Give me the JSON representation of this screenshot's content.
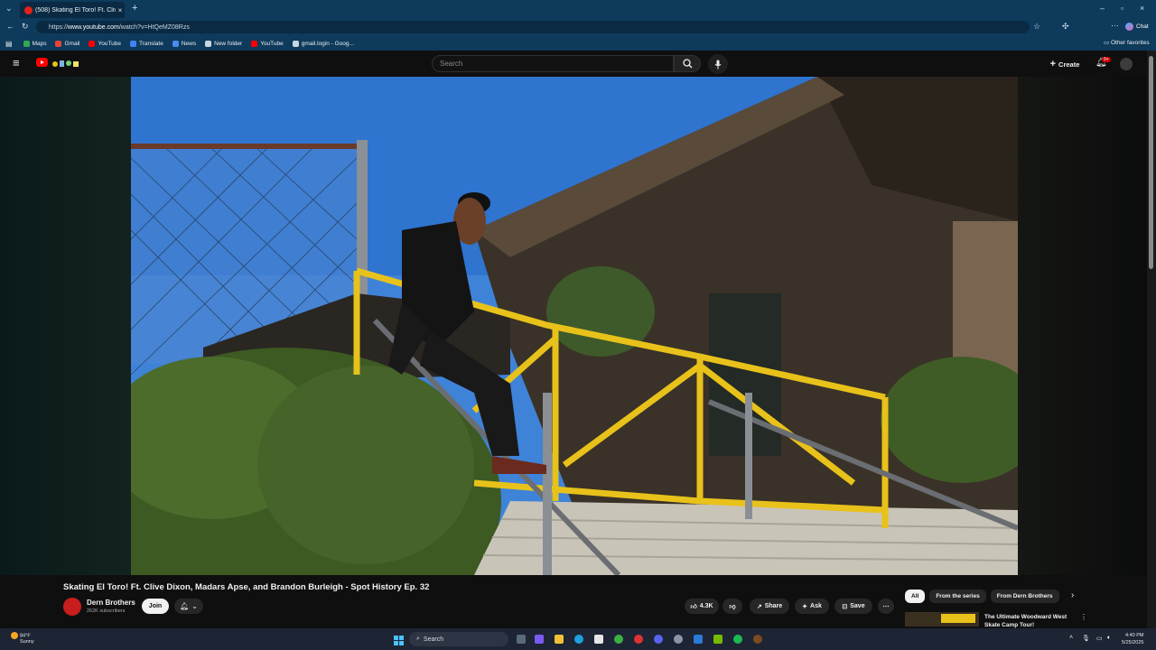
{
  "browser": {
    "tab_title": "(508) Skating El Toro! Ft. Clive",
    "url_prefix": "https://",
    "url_host": "www.youtube.com",
    "url_path": "/watch?v=HtQeMZ08Rzs",
    "chat_label": "Chat",
    "bookmarks": [
      {
        "label": "Maps",
        "color": "#34a853"
      },
      {
        "label": "Gmail",
        "color": "#ea4335"
      },
      {
        "label": "YouTube",
        "color": "#ff0000"
      },
      {
        "label": "Translate",
        "color": "#4285f4"
      },
      {
        "label": "News",
        "color": "#4a8af4"
      },
      {
        "label": "New folder",
        "color": "#c9d6e2"
      },
      {
        "label": "YouTube",
        "color": "#ff0000"
      },
      {
        "label": "gmail.login - Goog...",
        "color": "#c9d6e2"
      }
    ],
    "other_favorites": "Other favorites"
  },
  "youtube": {
    "search_placeholder": "Search",
    "create_label": "Create",
    "notification_count": "9+"
  },
  "video": {
    "title": "Skating El Toro! Ft. Clive Dixon, Madars Apse, and Brandon Burleigh - Spot History Ep. 32",
    "channel": "Dern Brothers",
    "subscribers": "262K subscribers",
    "join_label": "Join",
    "likes": "4.3K",
    "share_label": "Share",
    "ask_label": "Ask",
    "save_label": "Save"
  },
  "sidebar": {
    "chips": [
      "All",
      "From the series",
      "From Dern Brothers"
    ],
    "reco_title": "The Ultimate Woodward West Skate Camp Tour!"
  },
  "taskbar": {
    "search_label": "Search",
    "weather_temp": "84°F",
    "weather_desc": "Sunny",
    "time": "4:40 PM",
    "date": "5/25/2025"
  },
  "colors": {
    "browser_chrome": "#0e3a5b",
    "yt_background": "#0f0f0f",
    "yt_red": "#ff0000",
    "railing_yellow": "#e8c21a"
  }
}
